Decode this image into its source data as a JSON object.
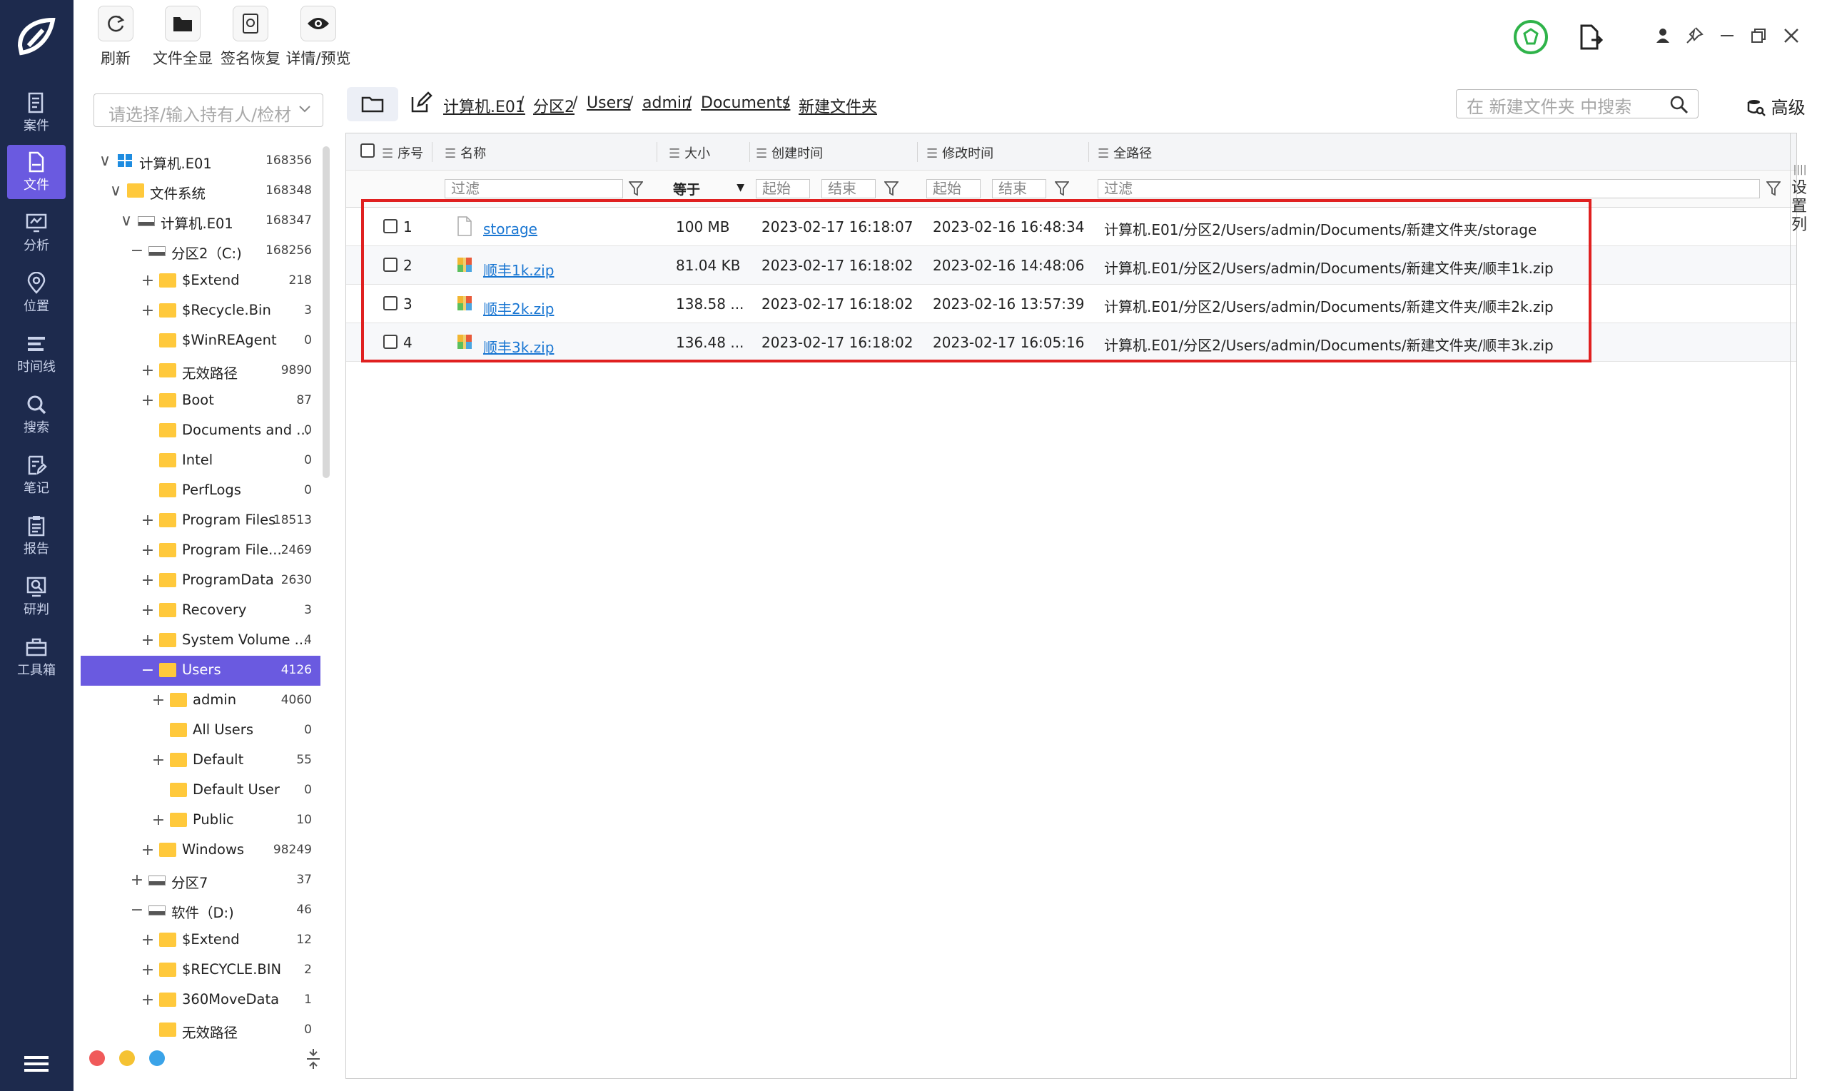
{
  "toolbar": {
    "refresh": "刷新",
    "show_all": "文件全显",
    "sig_recover": "签名恢复",
    "detail_preview": "详情/预览"
  },
  "rail": {
    "items": [
      {
        "label": "案件",
        "icon": "document-list-icon"
      },
      {
        "label": "文件",
        "icon": "file-icon"
      },
      {
        "label": "分析",
        "icon": "chart-monitor-icon"
      },
      {
        "label": "位置",
        "icon": "location-pin-icon"
      },
      {
        "label": "时间线",
        "icon": "timeline-icon"
      },
      {
        "label": "搜索",
        "icon": "search-icon"
      },
      {
        "label": "笔记",
        "icon": "note-edit-icon"
      },
      {
        "label": "报告",
        "icon": "clipboard-icon"
      },
      {
        "label": "研判",
        "icon": "analyze-icon"
      },
      {
        "label": "工具箱",
        "icon": "toolbox-icon"
      }
    ],
    "active_index": 1
  },
  "tree": {
    "placeholder": "请选择/输入持有人/检材",
    "rows": [
      {
        "label": "计算机.E01",
        "count": "168356",
        "exp": "∨",
        "icon": "windows"
      },
      {
        "label": "文件系统",
        "count": "168348",
        "exp": "∨",
        "icon": "folder"
      },
      {
        "label": "计算机.E01",
        "count": "168347",
        "exp": "∨",
        "icon": "drive"
      },
      {
        "label": "分区2（C:)",
        "count": "168256",
        "exp": "−",
        "icon": "drive"
      },
      {
        "label": "$Extend",
        "count": "218",
        "exp": "+",
        "icon": "folder"
      },
      {
        "label": "$Recycle.Bin",
        "count": "3",
        "exp": "+",
        "icon": "folder"
      },
      {
        "label": "$WinREAgent",
        "count": "0",
        "exp": "",
        "icon": "folder"
      },
      {
        "label": "无效路径",
        "count": "9890",
        "exp": "+",
        "icon": "folder"
      },
      {
        "label": "Boot",
        "count": "87",
        "exp": "+",
        "icon": "folder"
      },
      {
        "label": "Documents and ...",
        "count": "0",
        "exp": "",
        "icon": "folder"
      },
      {
        "label": "Intel",
        "count": "0",
        "exp": "",
        "icon": "folder"
      },
      {
        "label": "PerfLogs",
        "count": "0",
        "exp": "",
        "icon": "folder"
      },
      {
        "label": "Program Files",
        "count": "18513",
        "exp": "+",
        "icon": "folder"
      },
      {
        "label": "Program File...",
        "count": "2469",
        "exp": "+",
        "icon": "folder"
      },
      {
        "label": "ProgramData",
        "count": "2630",
        "exp": "+",
        "icon": "folder"
      },
      {
        "label": "Recovery",
        "count": "3",
        "exp": "+",
        "icon": "folder"
      },
      {
        "label": "System Volume ...",
        "count": "4",
        "exp": "+",
        "icon": "folder"
      },
      {
        "label": "Users",
        "count": "4126",
        "exp": "−",
        "icon": "folder",
        "selected": true
      },
      {
        "label": "admin",
        "count": "4060",
        "exp": "+",
        "icon": "folder"
      },
      {
        "label": "All Users",
        "count": "0",
        "exp": "",
        "icon": "folder"
      },
      {
        "label": "Default",
        "count": "55",
        "exp": "+",
        "icon": "folder"
      },
      {
        "label": "Default User",
        "count": "0",
        "exp": "",
        "icon": "folder"
      },
      {
        "label": "Public",
        "count": "10",
        "exp": "+",
        "icon": "folder"
      },
      {
        "label": "Windows",
        "count": "98249",
        "exp": "+",
        "icon": "folder"
      },
      {
        "label": "分区7",
        "count": "37",
        "exp": "+",
        "icon": "drive"
      },
      {
        "label": "软件（D:)",
        "count": "46",
        "exp": "−",
        "icon": "drive"
      },
      {
        "label": "$Extend",
        "count": "12",
        "exp": "+",
        "icon": "folder"
      },
      {
        "label": "$RECYCLE.BIN",
        "count": "2",
        "exp": "+",
        "icon": "folder"
      },
      {
        "label": "360MoveData",
        "count": "1",
        "exp": "+",
        "icon": "folder"
      },
      {
        "label": "无效路径",
        "count": "0",
        "exp": "",
        "icon": "folder"
      }
    ]
  },
  "breadcrumb": [
    "计算机.E01",
    "分区2",
    "Users",
    "admin",
    "Documents",
    "新建文件夹"
  ],
  "search": {
    "placeholder": "在 新建文件夹 中搜索"
  },
  "advanced_label": "高级",
  "table": {
    "headers": {
      "index": "序号",
      "name": "名称",
      "size": "大小",
      "created": "创建时间",
      "modified": "修改时间",
      "fullpath": "全路径"
    },
    "filter": {
      "name_placeholder": "过滤",
      "size_op": "等于",
      "start": "起始",
      "end": "结束",
      "path_placeholder": "过滤"
    },
    "rows": [
      {
        "index": "1",
        "name": "storage",
        "size": "100 MB",
        "created": "2023-02-17 16:18:07",
        "modified": "2023-02-16 16:48:34",
        "path": "计算机.E01/分区2/Users/admin/Documents/新建文件夹/storage",
        "type": "file"
      },
      {
        "index": "2",
        "name": "顺丰1k.zip",
        "size": "81.04 KB",
        "created": "2023-02-17 16:18:02",
        "modified": "2023-02-16 14:48:06",
        "path": "计算机.E01/分区2/Users/admin/Documents/新建文件夹/顺丰1k.zip",
        "type": "zip"
      },
      {
        "index": "3",
        "name": "顺丰2k.zip",
        "size": "138.58 ...",
        "created": "2023-02-17 16:18:02",
        "modified": "2023-02-16 13:57:39",
        "path": "计算机.E01/分区2/Users/admin/Documents/新建文件夹/顺丰2k.zip",
        "type": "zip"
      },
      {
        "index": "4",
        "name": "顺丰3k.zip",
        "size": "136.48 ...",
        "created": "2023-02-17 16:18:02",
        "modified": "2023-02-17 16:05:16",
        "path": "计算机.E01/分区2/Users/admin/Documents/新建文件夹/顺丰3k.zip",
        "type": "zip"
      }
    ]
  },
  "settings_column_label": "设置列",
  "colors": {
    "rail_bg": "#1d2a4d",
    "accent": "#6a5ae0",
    "highlight": "#e02020",
    "link": "#1976d2",
    "status_dots": [
      "#f05a5a",
      "#f5c232",
      "#3aa3e8"
    ]
  }
}
